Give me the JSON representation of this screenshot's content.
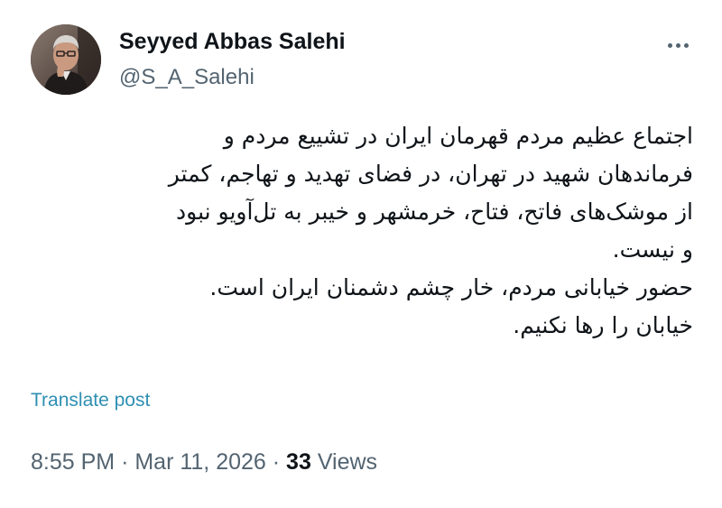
{
  "author": {
    "display_name": "Seyyed Abbas Salehi",
    "handle": "@S_A_Salehi"
  },
  "post": {
    "lines": [
      "اجتماع عظیم مردم قهرمان ایران در تشییع  مردم و",
      "فرماندهان شهید در تهران، در فضای تهدید و تهاجم، کمتر",
      "از موشک‌های فاتح،  فتاح، خرمشهر و خیبر به تل‌آویو نبود",
      "و نیست.",
      "حضور خیابانی مردم، خار چشم دشمنان ایران است.",
      "خیابان را رها نکنیم."
    ]
  },
  "translate_label": "Translate post",
  "meta": {
    "time": "8:55 PM",
    "separator": "·",
    "date": "Mar 11, 2026",
    "views_count": "33",
    "views_label": "Views"
  },
  "icons": {
    "more": "more-horizontal-icon"
  },
  "colors": {
    "link": "#2f8fb3",
    "secondary": "#536471",
    "text": "#0f1419"
  }
}
